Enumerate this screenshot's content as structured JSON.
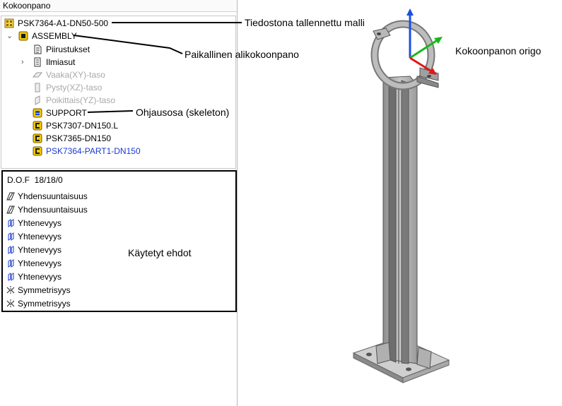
{
  "panel": {
    "title": "Kokoonpano"
  },
  "tree": {
    "root": {
      "label": "PSK7364-A1-DN50-500",
      "icon": "assembly-file-icon"
    },
    "assembly": {
      "label": "ASSEMBLY",
      "icon": "subassembly-icon"
    },
    "items": [
      {
        "label": "Piirustukset",
        "icon": "drawings-icon",
        "state": "normal"
      },
      {
        "label": "Ilmiasut",
        "icon": "representations-icon",
        "state": "normal"
      },
      {
        "label": "Vaaka(XY)-taso",
        "icon": "plane-icon",
        "state": "disabled"
      },
      {
        "label": "Pysty(XZ)-taso",
        "icon": "plane-icon",
        "state": "disabled"
      },
      {
        "label": "Poikittais(YZ)-taso",
        "icon": "plane-icon",
        "state": "disabled"
      },
      {
        "label": "SUPPORT",
        "icon": "skeleton-part-icon",
        "state": "normal"
      },
      {
        "label": "PSK7307-DN150.L",
        "icon": "part-icon",
        "state": "normal"
      },
      {
        "label": "PSK7365-DN150",
        "icon": "part-icon",
        "state": "normal"
      },
      {
        "label": "PSK7364-PART1-DN150",
        "icon": "part-icon",
        "state": "active"
      }
    ]
  },
  "constraints": {
    "dof_label": "D.O.F",
    "dof_value": "18/18/0",
    "items": [
      {
        "label": "Yhdensuuntaisuus",
        "icon": "parallel-constraint-icon"
      },
      {
        "label": "Yhdensuuntaisuus",
        "icon": "parallel-constraint-icon"
      },
      {
        "label": "Yhtenevyys",
        "icon": "coincident-constraint-icon"
      },
      {
        "label": "Yhtenevyys",
        "icon": "coincident-constraint-icon"
      },
      {
        "label": "Yhtenevyys",
        "icon": "coincident-constraint-icon"
      },
      {
        "label": "Yhtenevyys",
        "icon": "coincident-constraint-icon"
      },
      {
        "label": "Yhtenevyys",
        "icon": "coincident-constraint-icon"
      },
      {
        "label": "Symmetrisyys",
        "icon": "symmetry-constraint-icon"
      },
      {
        "label": "Symmetrisyys",
        "icon": "symmetry-constraint-icon"
      }
    ]
  },
  "annotations": {
    "saved_model": "Tiedostona tallennettu malli",
    "local_subassembly": "Paikallinen alikokoonpano",
    "skeleton": "Ohjausosa (skeleton)",
    "constraints_used": "Käytetyt ehdot",
    "origin": "Kokoonpanon origo"
  },
  "colors": {
    "part_yellow": "#f0c800",
    "active_blue": "#1a3ad0",
    "disabled_gray": "#a8a8a8",
    "axis_x": "#e01818",
    "axis_y": "#18b818",
    "axis_z": "#1850e0"
  }
}
